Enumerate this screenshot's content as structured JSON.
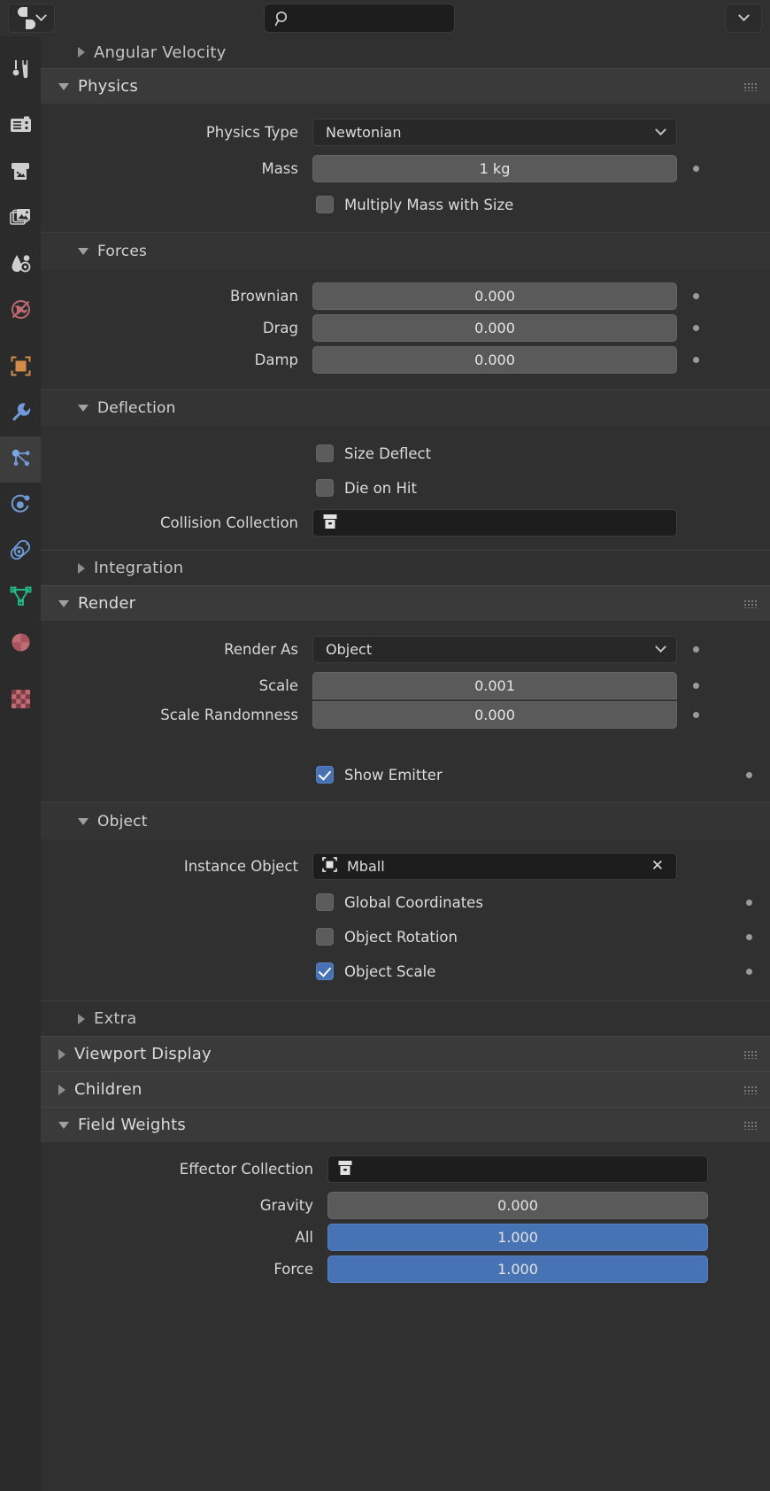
{
  "topbar": {
    "editor_type_icon": "properties-editor-icon",
    "search_value": "",
    "search_placeholder": "",
    "menu_icon": "chevron-down-icon"
  },
  "rail": {
    "items": [
      {
        "name": "tool-tab",
        "icon": "tool-icon",
        "selected": false
      },
      {
        "name": "render-tab",
        "icon": "camera-back-icon",
        "selected": false
      },
      {
        "name": "output-tab",
        "icon": "printer-icon",
        "selected": false
      },
      {
        "name": "view-layer-tab",
        "icon": "images-icon",
        "selected": false
      },
      {
        "name": "scene-tab",
        "icon": "scene-cone-droplet-icon",
        "selected": false
      },
      {
        "name": "world-tab",
        "icon": "world-globe-icon",
        "selected": false
      },
      {
        "name": "object-tab",
        "icon": "object-square-icon",
        "selected": false
      },
      {
        "name": "modifiers-tab",
        "icon": "wrench-icon",
        "selected": false
      },
      {
        "name": "particles-tab",
        "icon": "particles-node-icon",
        "selected": true
      },
      {
        "name": "physics-tab",
        "icon": "physics-orbit-icon",
        "selected": false
      },
      {
        "name": "object-constraints-tab",
        "icon": "constraint-icon",
        "selected": false
      },
      {
        "name": "object-data-tab",
        "icon": "mesh-data-triangle-icon",
        "selected": false
      },
      {
        "name": "material-tab",
        "icon": "material-sphere-icon",
        "selected": false
      },
      {
        "name": "texture-tab",
        "icon": "texture-checker-icon",
        "selected": false
      }
    ]
  },
  "panels": {
    "angular_velocity": {
      "label": "Angular Velocity",
      "expanded": false
    },
    "physics": {
      "label": "Physics",
      "expanded": true,
      "physics_type": {
        "label": "Physics Type",
        "value": "Newtonian"
      },
      "mass": {
        "label": "Mass",
        "value": "1 kg"
      },
      "multiply_mass_with_size": {
        "label": "Multiply Mass with Size",
        "checked": false
      },
      "forces": {
        "label": "Forces",
        "expanded": true,
        "brownian": {
          "label": "Brownian",
          "value": "0.000"
        },
        "drag": {
          "label": "Drag",
          "value": "0.000"
        },
        "damp": {
          "label": "Damp",
          "value": "0.000"
        }
      },
      "deflection": {
        "label": "Deflection",
        "expanded": true,
        "size_deflect": {
          "label": "Size Deflect",
          "checked": false
        },
        "die_on_hit": {
          "label": "Die on Hit",
          "checked": false
        },
        "collision_collection": {
          "label": "Collision Collection",
          "value": ""
        }
      },
      "integration": {
        "label": "Integration",
        "expanded": false
      }
    },
    "render": {
      "label": "Render",
      "expanded": true,
      "render_as": {
        "label": "Render As",
        "value": "Object"
      },
      "scale": {
        "label": "Scale",
        "value": "0.001"
      },
      "scale_randomness": {
        "label": "Scale Randomness",
        "value": "0.000"
      },
      "show_emitter": {
        "label": "Show Emitter",
        "checked": true
      },
      "object": {
        "label": "Object",
        "expanded": true,
        "instance_object": {
          "label": "Instance Object",
          "value": "Mball",
          "icon": "object-square-icon",
          "clear_icon": "close-x-icon"
        },
        "global_coordinates": {
          "label": "Global Coordinates",
          "checked": false
        },
        "object_rotation": {
          "label": "Object Rotation",
          "checked": false
        },
        "object_scale": {
          "label": "Object Scale",
          "checked": true
        }
      },
      "extra": {
        "label": "Extra",
        "expanded": false
      }
    },
    "viewport_display": {
      "label": "Viewport Display",
      "expanded": false
    },
    "children": {
      "label": "Children",
      "expanded": false
    },
    "field_weights": {
      "label": "Field Weights",
      "expanded": true,
      "effector_collection": {
        "label": "Effector Collection",
        "value": ""
      },
      "gravity": {
        "label": "Gravity",
        "value": "0.000"
      },
      "all": {
        "label": "All",
        "value": "1.000"
      },
      "force": {
        "label": "Force",
        "value": "1.000"
      }
    }
  },
  "colors": {
    "background": "#303030",
    "panel_header": "#3a3a3a",
    "rail": "#2b2b2b",
    "accent_blue": "#4772b3",
    "field": "#5a5a5a",
    "field_dark": "#282828",
    "text": "#dcdcdc"
  }
}
